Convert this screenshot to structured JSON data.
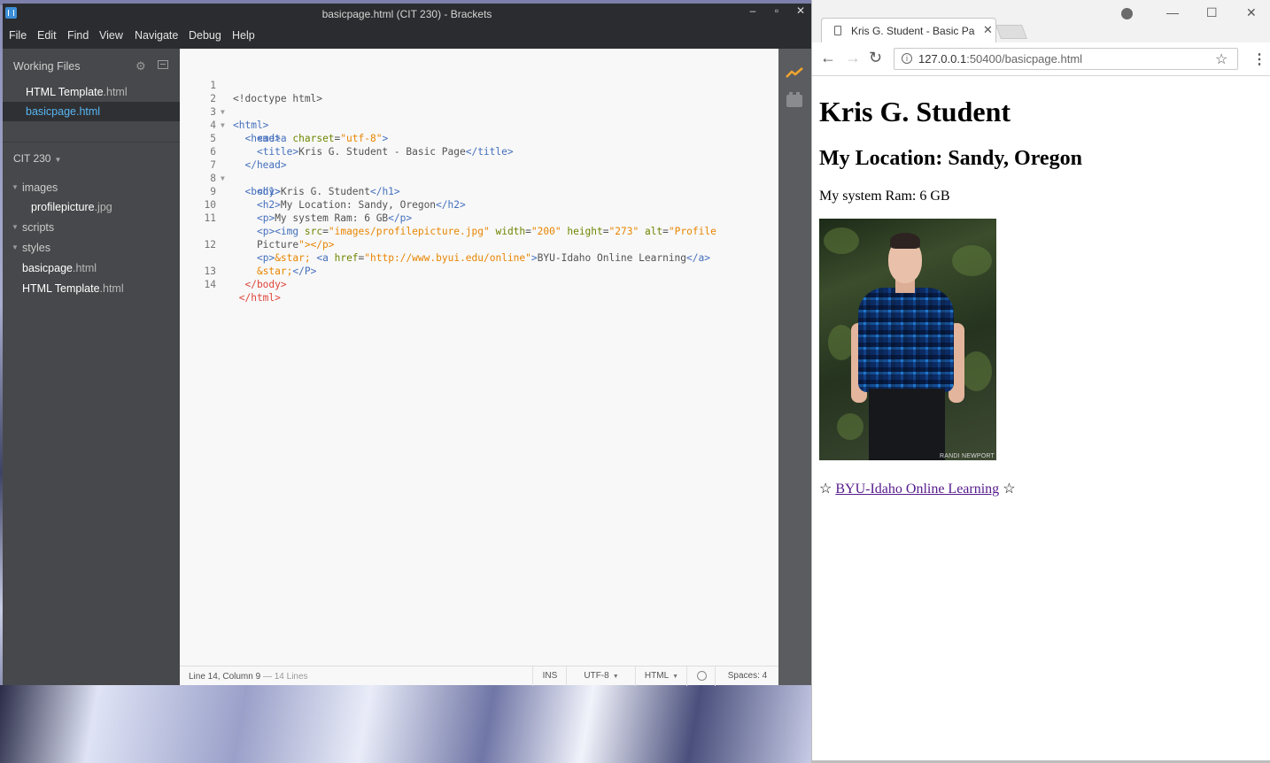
{
  "brackets": {
    "window_title": "basicpage.html (CIT 230) - Brackets",
    "controls": {
      "minimize": "–",
      "maximize": "▫",
      "close": "✕"
    },
    "menu": [
      "File",
      "Edit",
      "Find",
      "View",
      "Navigate",
      "Debug",
      "Help"
    ],
    "working_files": {
      "title": "Working Files",
      "items": [
        {
          "name": "HTML Template",
          "ext": ".html",
          "selected": false
        },
        {
          "name": "basicpage",
          "ext": ".html",
          "selected": true
        }
      ]
    },
    "project": {
      "name": "CIT 230",
      "tree": [
        {
          "type": "folder",
          "name": "images",
          "open": true
        },
        {
          "type": "file",
          "name": "profilepicture",
          "ext": ".jpg",
          "depth": 1
        },
        {
          "type": "folder",
          "name": "scripts",
          "open": false
        },
        {
          "type": "folder",
          "name": "styles",
          "open": false
        },
        {
          "type": "file",
          "name": "basicpage",
          "ext": ".html",
          "depth": 0
        },
        {
          "type": "file",
          "name": "HTML Template",
          "ext": ".html",
          "depth": 0
        }
      ]
    },
    "editor": {
      "line_numbers": [
        "1",
        "2",
        "3",
        "4",
        "5",
        "6",
        "7",
        "8",
        "9",
        "10",
        "11",
        "",
        "12",
        "",
        "13",
        "14"
      ],
      "code_lines": [
        "<!doctype html>",
        "<html>",
        "  <head>",
        "    <meta charset=\"utf-8\">",
        "    <title>Kris G. Student - Basic Page</title>",
        "  </head>",
        "  <body>",
        "    <h1>Kris G. Student</h1>",
        "    <h2>My Location: Sandy, Oregon</h2>",
        "    <p>My system Ram: 6 GB</p>",
        "    <p><img src=\"images/profilepicture.jpg\" width=\"200\" height=\"273\" alt=\"Profile",
        "    Picture\"></p>",
        "    <p>&star; <a href=\"http://www.byui.edu/online\">BYU-Idaho Online Learning</a>",
        "    &star;</P>",
        "  </body>",
        " </html>"
      ]
    },
    "status_bar": {
      "position": "Line 14, Column 9",
      "lines": "— 14 Lines",
      "mode": "INS",
      "encoding": "UTF-8",
      "language": "HTML",
      "spaces": "Spaces:  4"
    }
  },
  "chrome": {
    "tab_title": "Kris G. Student - Basic Page",
    "tab_close": "✕",
    "window_controls": {
      "minimize": "—",
      "maximize": "☐",
      "close": "✕"
    },
    "url_host": "127.0.0.1",
    "url_path": ":50400/basicpage.html",
    "page": {
      "h1": "Kris G. Student",
      "h2": "My Location: Sandy, Oregon",
      "p_ram": "My system Ram: 6 GB",
      "image_credit": "RANDI NEWPORT",
      "star_left": "☆",
      "link_text": "BYU-Idaho Online Learning",
      "star_right": "☆"
    }
  },
  "colors": {
    "brackets_bg": "#47484b",
    "brackets_selected_file": "#57b6f3",
    "tag": "#446fbd",
    "attribute": "#6d8600",
    "string": "#e88501",
    "link_visited": "#551a8b"
  }
}
